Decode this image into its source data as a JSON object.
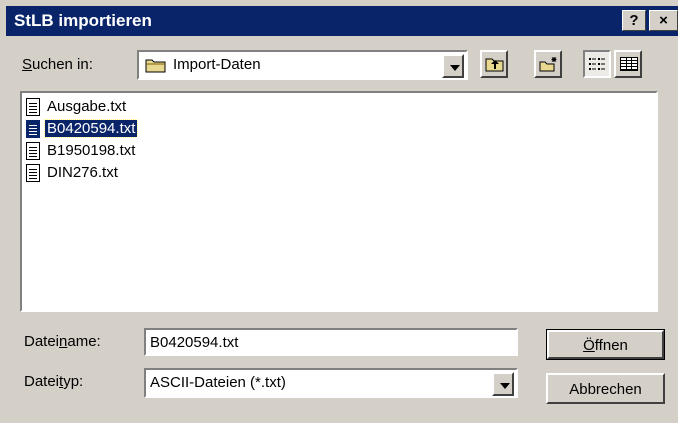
{
  "window": {
    "title": "StLB importieren",
    "help_button": "?",
    "close_button": "×"
  },
  "lookin": {
    "label_pre": "",
    "label_accel": "S",
    "label_post": "uchen in:",
    "value": "Import-Daten",
    "folder_icon": "folder-icon"
  },
  "toolbar": {
    "up": "up-one-level-icon",
    "new_folder": "new-folder-icon",
    "list_view": "list-view-icon",
    "details_view": "details-view-icon"
  },
  "files": [
    {
      "name": "Ausgabe.txt",
      "selected": false
    },
    {
      "name": "B0420594.txt",
      "selected": true
    },
    {
      "name": "B1950198.txt",
      "selected": false
    },
    {
      "name": "DIN276.txt",
      "selected": false
    }
  ],
  "filename": {
    "label_pre": "Datei",
    "label_accel": "n",
    "label_post": "ame:",
    "value": "B0420594.txt"
  },
  "filetype": {
    "label_pre": "Datei",
    "label_accel": "t",
    "label_post": "yp:",
    "value": "ASCII-Dateien (*.txt)"
  },
  "buttons": {
    "open_pre": "",
    "open_accel": "Ö",
    "open_post": "ffnen",
    "cancel": "Abbrechen"
  }
}
